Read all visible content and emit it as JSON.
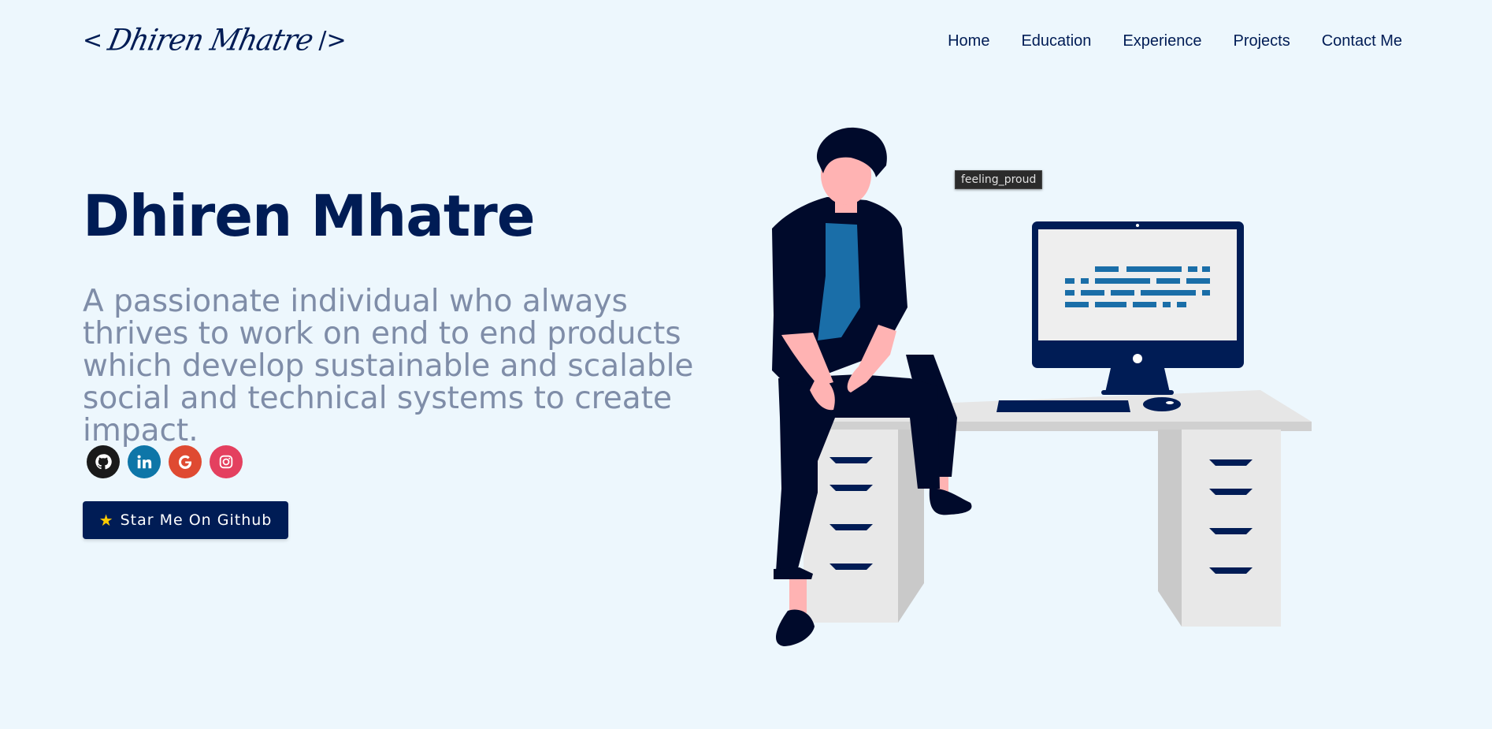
{
  "header": {
    "logo": {
      "bracket_open": "<",
      "signature": "Dhiren Mhatre",
      "bracket_close": "/>"
    },
    "nav": [
      "Home",
      "Education",
      "Experience",
      "Projects",
      "Contact Me"
    ]
  },
  "hero": {
    "title": "Dhiren Mhatre",
    "subtitle": "A passionate individual who always thrives to work on end to end products which develop sustainable and scalable social and technical systems to create impact.",
    "socials": [
      {
        "icon": "github-icon",
        "color": "#1a1a1a"
      },
      {
        "icon": "linkedin-icon",
        "color": "#0e76a8"
      },
      {
        "icon": "google-icon",
        "color": "#df4a32"
      },
      {
        "icon": "instagram-icon",
        "color": "#e4405f"
      }
    ],
    "star_button": {
      "icon": "star-icon",
      "label": "Star Me On Github"
    }
  },
  "illustration": {
    "tooltip": "feeling_proud"
  },
  "colors": {
    "background": "#edf7fd",
    "primary": "#001c55",
    "subtitle": "#7f8da8",
    "accent_blue": "#1a6ea8"
  }
}
